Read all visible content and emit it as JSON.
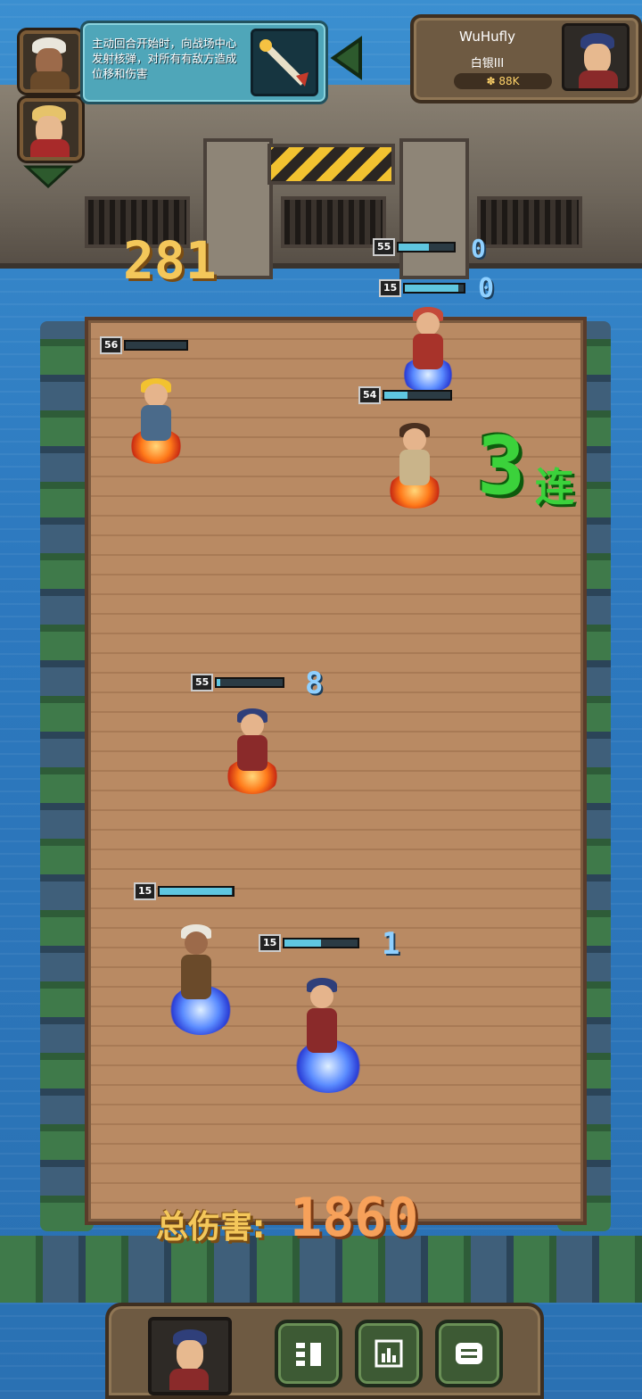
{
  "skill": {
    "description": "主动回合开始时，向战场中心发射核弹，对所有有敌方造成位移和伤害"
  },
  "player": {
    "name": "WuHufly",
    "rank": "白银III",
    "power": "88K",
    "power_icon": "paw-icon"
  },
  "combat": {
    "turn_damage": "281",
    "combo_count": "3",
    "combo_label": "连",
    "total_label": "总伤害:",
    "total_value": "1860"
  },
  "units": [
    {
      "level": "55",
      "hp": 0.55,
      "damage": "0",
      "side": "enemy"
    },
    {
      "level": "15",
      "hp": 0.9,
      "damage": "0",
      "side": "enemy"
    },
    {
      "level": "56",
      "hp": 0.0,
      "side": "enemy"
    },
    {
      "level": "54",
      "hp": 0.35,
      "side": "enemy"
    },
    {
      "level": "55",
      "hp": 0.05,
      "damage": "8",
      "side": "enemy"
    },
    {
      "level": "15",
      "hp": 0.98,
      "side": "ally"
    },
    {
      "level": "15",
      "hp": 0.5,
      "damage": "1",
      "side": "ally"
    }
  ],
  "dock": {
    "buttons": [
      "formation-icon",
      "stats-icon",
      "chat-icon"
    ]
  },
  "colors": {
    "hp_fill": "#5fc6e0",
    "combo": "#3bd23b",
    "total_value": "#f7a15a",
    "total_label": "#f4c75a"
  }
}
